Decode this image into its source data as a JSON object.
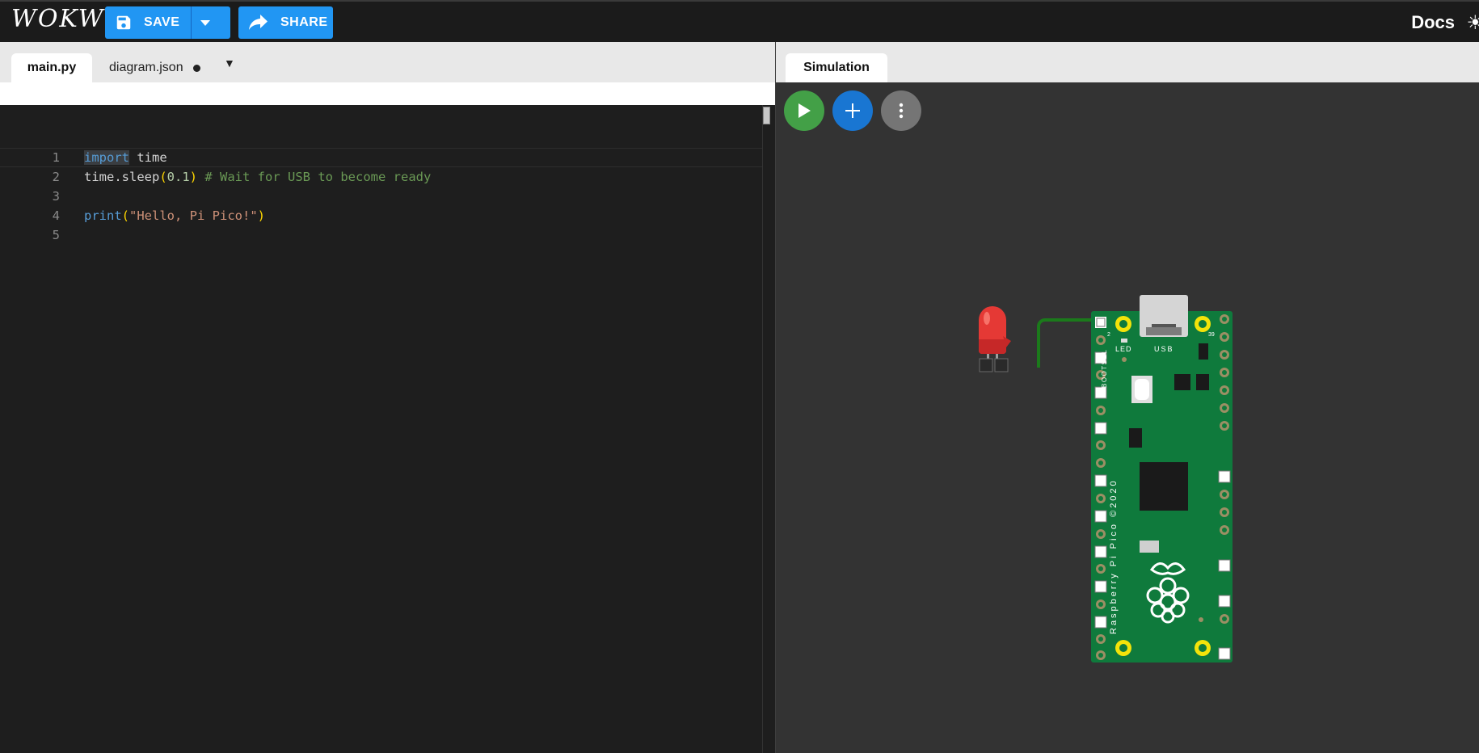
{
  "topbar": {
    "logo": "WOKWi",
    "save_label": "SAVE",
    "share_label": "SHARE",
    "docs_label": "Docs"
  },
  "editor": {
    "tabs": [
      {
        "label": "main.py",
        "active": true
      },
      {
        "label": "diagram.json",
        "active": false,
        "modified": true
      }
    ],
    "lines": [
      {
        "number": "1",
        "text": "import time"
      },
      {
        "number": "2",
        "text": "time.sleep(0.1) # Wait for USB to become ready"
      },
      {
        "number": "3",
        "text": ""
      },
      {
        "number": "4",
        "text": "print(\"Hello, Pi Pico!\")"
      },
      {
        "number": "5",
        "text": ""
      }
    ]
  },
  "simulation": {
    "tab_label": "Simulation",
    "board": {
      "name": "Raspberry Pi Pico ©2020",
      "labels": {
        "led": "LED",
        "usb": "USB",
        "bootsel": "BOOTSEL",
        "pin_left": "2",
        "pin_right": "39"
      }
    },
    "led_color": "#e53935",
    "wire_color": "#1b7a1b",
    "board_color": "#0f7a3c"
  },
  "colors": {
    "accent": "#2196f3",
    "play": "#43a047",
    "add": "#1976d2",
    "more": "#757575"
  }
}
